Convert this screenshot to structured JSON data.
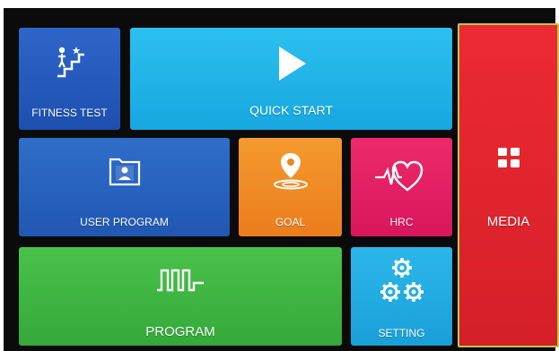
{
  "tiles": {
    "fitness_test": {
      "label": "FITNESS TEST",
      "icon": "stairs-person-icon",
      "color": "#2e66c8"
    },
    "quick_start": {
      "label": "QUICK START",
      "icon": "play-icon",
      "color": "#2cc0ef"
    },
    "user_program": {
      "label": "USER PROGRAM",
      "icon": "user-folder-icon",
      "color": "#2f6ec9"
    },
    "goal": {
      "label": "GOAL",
      "icon": "location-pin-icon",
      "color": "#f49a2e"
    },
    "hrc": {
      "label": "HRC",
      "icon": "heart-pulse-icon",
      "color": "#ec2a6b"
    },
    "program": {
      "label": "PROGRAM",
      "icon": "square-wave-icon",
      "color": "#49c24a"
    },
    "setting": {
      "label": "SETTING",
      "icon": "gears-icon",
      "color": "#2bb7ea"
    },
    "media": {
      "label": "MEDIA",
      "icon": "grid-icon",
      "color": "#ec2a33"
    }
  }
}
